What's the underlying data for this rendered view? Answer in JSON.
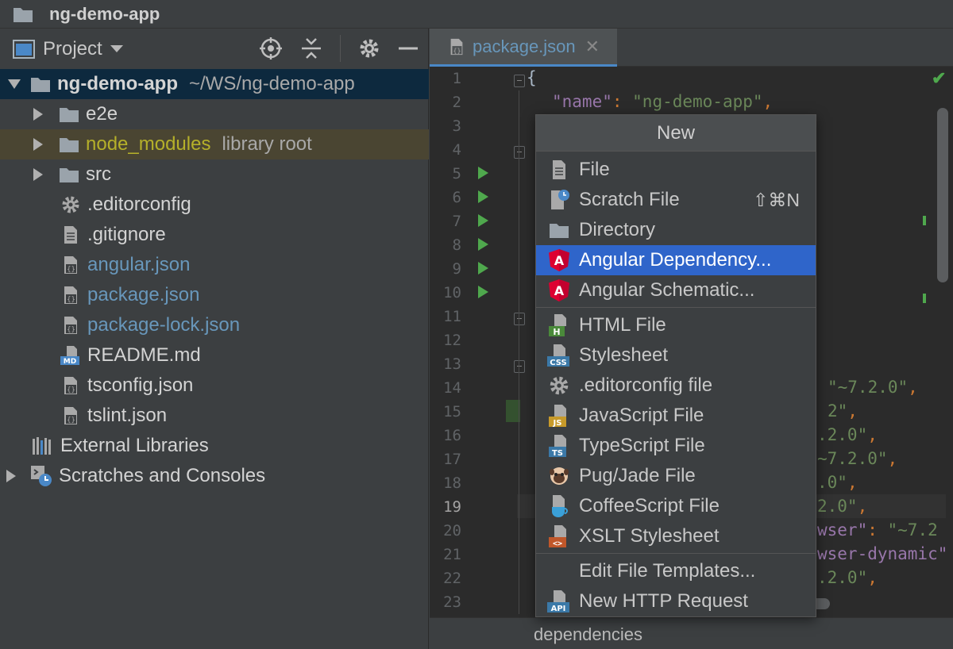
{
  "window": {
    "title": "ng-demo-app"
  },
  "project_panel": {
    "title": "Project",
    "tree": [
      {
        "label": "ng-demo-app",
        "hint": "~/WS/ng-demo-app"
      },
      {
        "label": "e2e"
      },
      {
        "label": "node_modules",
        "hint": "library root"
      },
      {
        "label": "src"
      },
      {
        "label": ".editorconfig"
      },
      {
        "label": ".gitignore"
      },
      {
        "label": "angular.json"
      },
      {
        "label": "package.json"
      },
      {
        "label": "package-lock.json"
      },
      {
        "label": "README.md"
      },
      {
        "label": "tsconfig.json"
      },
      {
        "label": "tslint.json"
      },
      {
        "label": "External Libraries"
      },
      {
        "label": "Scratches and Consoles"
      }
    ],
    "icon_text": {
      "md": "MD"
    }
  },
  "editor": {
    "tab": {
      "label": "package.json",
      "close": "✕"
    },
    "line_numbers": [
      "1",
      "2",
      "3",
      "4",
      "5",
      "6",
      "7",
      "8",
      "9",
      "10",
      "11",
      "12",
      "13",
      "14",
      "15",
      "16",
      "17",
      "18",
      "19",
      "20",
      "21",
      "22",
      "23"
    ],
    "current_line": "19",
    "code": {
      "l1": "{",
      "l2_key": "\"name\"",
      "l2_colon": ": ",
      "l2_val": "\"ng-demo-app\"",
      "l2_comma": ",",
      "l14": "\"~7.2.0\"",
      "l14_comma": ",",
      "l15": "2\"",
      "l15_comma": ",",
      "l16": ".2.0\"",
      "l16_comma": ",",
      "l17": "~7.2.0\"",
      "l17_comma": ",",
      "l18": ".0\"",
      "l18_comma": ",",
      "l19": "2.0\"",
      "l19_comma": ",",
      "l20_key": "wser\"",
      "l20_colon": ": ",
      "l20_val": "\"~7.2",
      "l21_key": "wser-dynamic\"",
      "l22": ".2.0\"",
      "l22_comma": ","
    },
    "breadcrumb": "dependencies",
    "inspection_icon": "check-icon"
  },
  "popup": {
    "title": "New",
    "items": [
      {
        "label": "File",
        "icon": "file-icon"
      },
      {
        "label": "Scratch File",
        "icon": "scratch-file-icon",
        "shortcut": "⇧⌘N"
      },
      {
        "label": "Directory",
        "icon": "folder-icon"
      },
      {
        "label": "Angular Dependency...",
        "icon": "angular-icon",
        "selected": true
      },
      {
        "label": "Angular Schematic...",
        "icon": "angular-icon"
      },
      {
        "label": "HTML File",
        "icon": "html-file-icon",
        "badge": "H"
      },
      {
        "label": "Stylesheet",
        "icon": "css-file-icon",
        "badge": "CSS"
      },
      {
        "label": ".editorconfig file",
        "icon": "gear-icon"
      },
      {
        "label": "JavaScript File",
        "icon": "js-file-icon",
        "badge": "JS"
      },
      {
        "label": "TypeScript File",
        "icon": "ts-file-icon",
        "badge": "TS"
      },
      {
        "label": "Pug/Jade File",
        "icon": "pug-icon"
      },
      {
        "label": "CoffeeScript File",
        "icon": "coffeescript-icon"
      },
      {
        "label": "XSLT Stylesheet",
        "icon": "xslt-file-icon",
        "badge": "<>"
      },
      {
        "label": "Edit File Templates...",
        "icon": ""
      },
      {
        "label": "New HTTP Request",
        "icon": "http-request-icon",
        "badge": "API"
      }
    ],
    "angular_letter": "A"
  },
  "colors": {
    "selection": "#2f65ca",
    "json_key": "#9876aa",
    "json_string": "#6a8759",
    "link_blue": "#6897bb",
    "library_root": "#b5b02a"
  }
}
